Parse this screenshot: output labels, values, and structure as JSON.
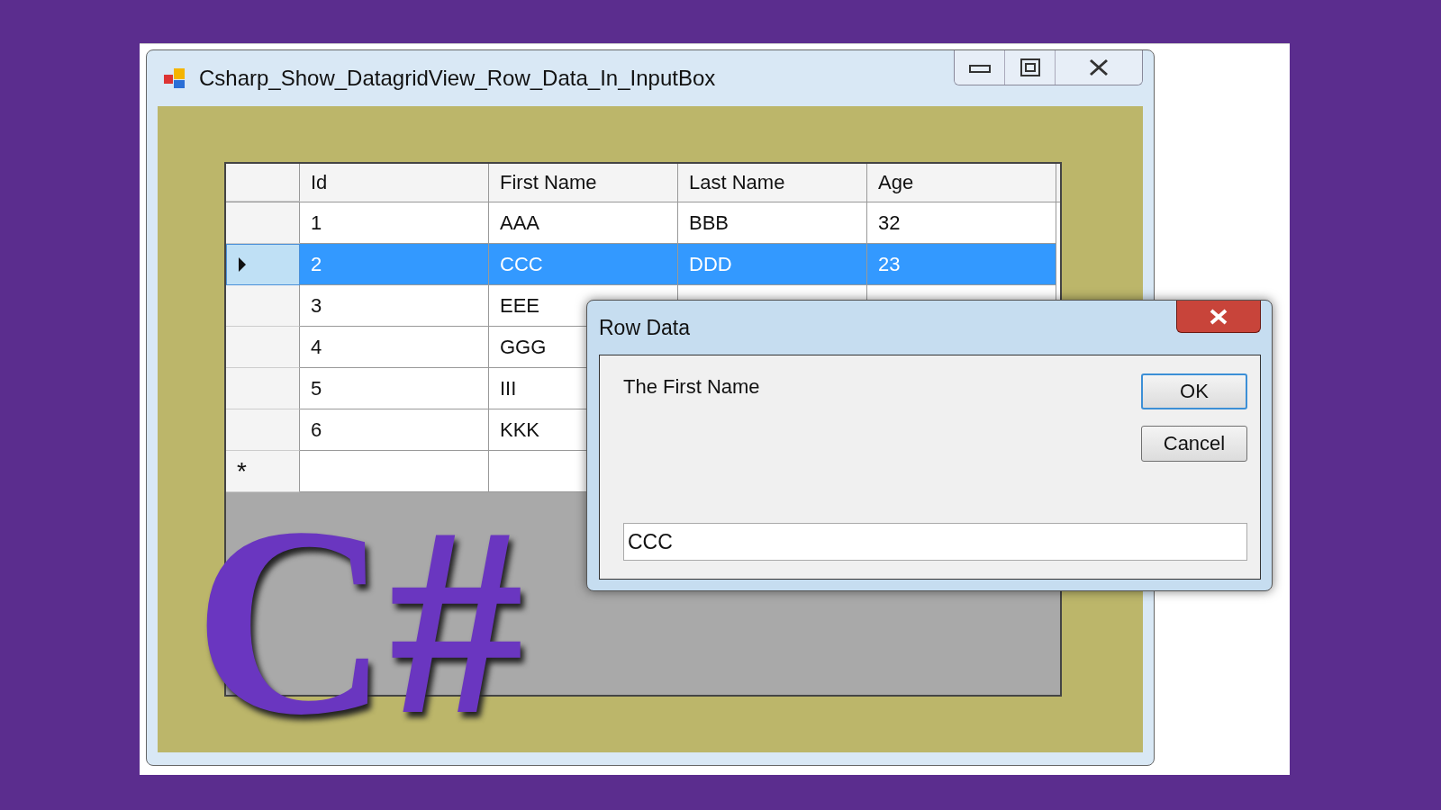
{
  "window": {
    "title": "Csharp_Show_DatagridView_Row_Data_In_InputBox"
  },
  "grid": {
    "columns": [
      "Id",
      "First Name",
      "Last Name",
      "Age"
    ],
    "rows": [
      {
        "cells": [
          "1",
          "AAA",
          "BBB",
          "32"
        ],
        "selected": false
      },
      {
        "cells": [
          "2",
          "CCC",
          "DDD",
          "23"
        ],
        "selected": true
      },
      {
        "cells": [
          "3",
          "EEE"
        ],
        "selected": false
      },
      {
        "cells": [
          "4",
          "GGG"
        ],
        "selected": false
      },
      {
        "cells": [
          "5",
          "III"
        ],
        "selected": false
      },
      {
        "cells": [
          "6",
          "KKK"
        ],
        "selected": false
      }
    ],
    "new_row_marker": "*"
  },
  "logo": "C#",
  "dialog": {
    "title": "Row Data",
    "prompt": "The First Name",
    "value": "CCC",
    "buttons": [
      "OK",
      "Cancel"
    ]
  }
}
